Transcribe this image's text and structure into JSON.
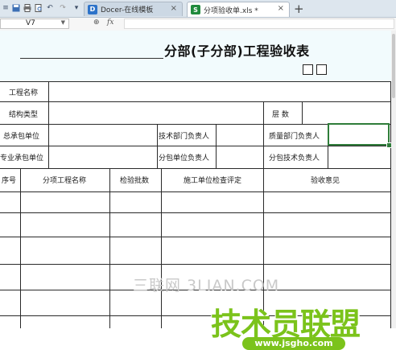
{
  "tabs": [
    {
      "label": "Docer-在线模板",
      "active": false,
      "icon": "docer-icon"
    },
    {
      "label": "分项验收单.xls *",
      "active": true,
      "icon": "spreadsheet-icon"
    }
  ],
  "tab_close_glyph": "×",
  "new_tab_glyph": "+",
  "formula_bar": {
    "cell_ref": "V7",
    "fx_label": "fx",
    "value": ""
  },
  "form": {
    "title": "分部(子分部)工程验收表",
    "labels": {
      "project_name": "工程名称",
      "structure_type": "结构类型",
      "floors": "层 数",
      "general_contractor": "总承包单位",
      "tech_dept_head": "技术部门负责人",
      "quality_dept_head": "质量部门负责人",
      "specialty_contractor": "专业承包单位",
      "sub_unit_head": "分包单位负责人",
      "sub_tech_head": "分包技术负责人"
    },
    "columns": [
      "序号",
      "分项工程名称",
      "检验批数",
      "施工单位检查评定",
      "验收意见"
    ]
  },
  "watermarks": {
    "line1": "三联网 3LIAN.COM",
    "line2": "技术员联盟",
    "line3": "www.jsgho.com"
  },
  "colors": {
    "selection": "#2f7d3a",
    "watermark_green": "#7bc31b",
    "tab_bar": "#dde6ee"
  }
}
